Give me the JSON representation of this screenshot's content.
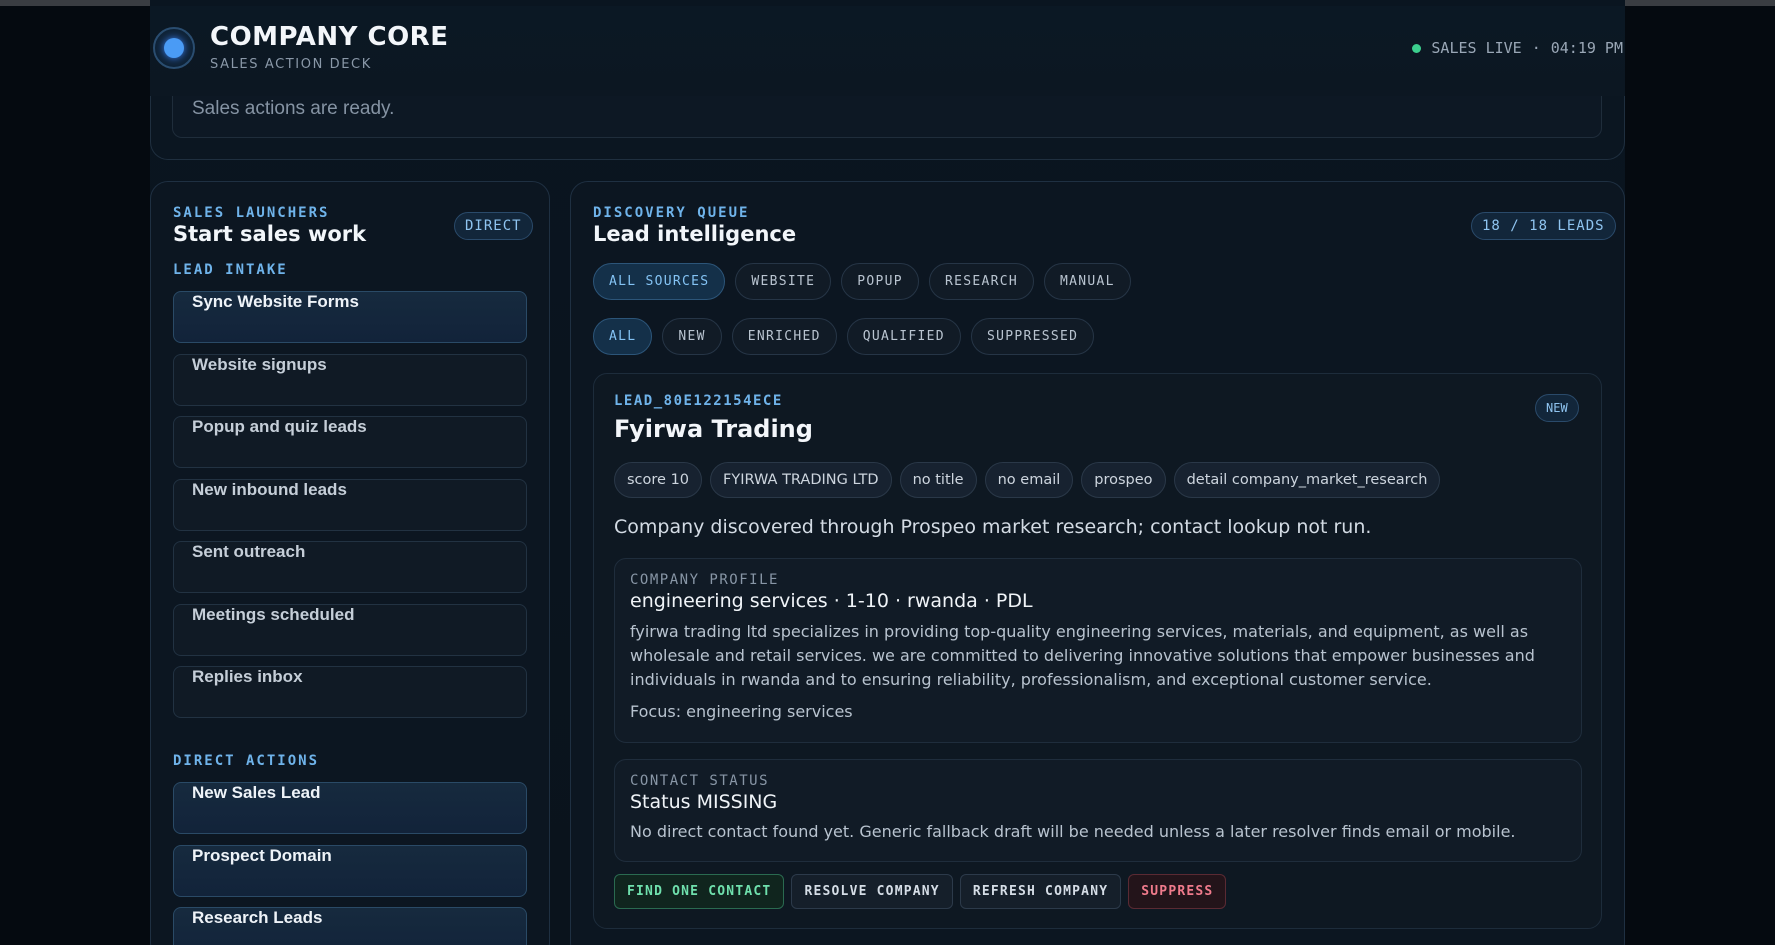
{
  "header": {
    "title": "COMPANY CORE",
    "subtitle": "SALES ACTION DECK",
    "live_label": "SALES LIVE",
    "separator": "·",
    "time": "04:19 PM",
    "status_message": "Sales actions are ready."
  },
  "launchers": {
    "eyebrow": "SALES LAUNCHERS",
    "title": "Start sales work",
    "badge": "DIRECT",
    "intake_heading": "LEAD INTAKE",
    "intake_items": [
      {
        "label": "Sync Website Forms"
      },
      {
        "label": "Website signups"
      },
      {
        "label": "Popup and quiz leads"
      },
      {
        "label": "New inbound leads"
      },
      {
        "label": "Sent outreach"
      },
      {
        "label": "Meetings scheduled"
      },
      {
        "label": "Replies inbox"
      }
    ],
    "direct_heading": "DIRECT ACTIONS",
    "direct_items": [
      {
        "label": "New Sales Lead"
      },
      {
        "label": "Prospect Domain"
      },
      {
        "label": "Research Leads"
      }
    ]
  },
  "queue": {
    "eyebrow": "DISCOVERY QUEUE",
    "title": "Lead intelligence",
    "count_badge": "18 / 18 LEADS",
    "source_filters": [
      "ALL SOURCES",
      "WEBSITE",
      "POPUP",
      "RESEARCH",
      "MANUAL"
    ],
    "status_filters": [
      "ALL",
      "NEW",
      "ENRICHED",
      "QUALIFIED",
      "SUPPRESSED"
    ],
    "active_source": "ALL SOURCES",
    "active_status": "ALL"
  },
  "lead": {
    "id": "LEAD_80E122154ECE",
    "name": "Fyirwa Trading",
    "badge": "NEW",
    "chips": [
      "score 10",
      "FYIRWA TRADING LTD",
      "no title",
      "no email",
      "prospeo",
      "detail company_market_research"
    ],
    "description": "Company discovered through Prospeo market research; contact lookup not run.",
    "profile": {
      "eyebrow": "COMPANY PROFILE",
      "title": "engineering services · 1-10 · rwanda · PDL",
      "body": "fyirwa trading ltd specializes in providing top-quality engineering services, materials, and equipment, as well as wholesale and retail services. we are committed to delivering innovative solutions that empower businesses and individuals in rwanda and to ensuring reliability, professionalism, and exceptional customer service.",
      "focus": "Focus: engineering services"
    },
    "contact": {
      "eyebrow": "CONTACT STATUS",
      "title": "Status MISSING",
      "body": "No direct contact found yet. Generic fallback draft will be needed unless a later resolver finds email or mobile."
    },
    "actions": [
      "FIND ONE CONTACT",
      "RESOLVE COMPANY",
      "REFRESH COMPANY",
      "SUPPRESS"
    ]
  },
  "colors": {
    "accent": "#6fb3ea",
    "live": "#3ccf8e",
    "danger": "#f07b8c",
    "success": "#6fe0ad"
  }
}
